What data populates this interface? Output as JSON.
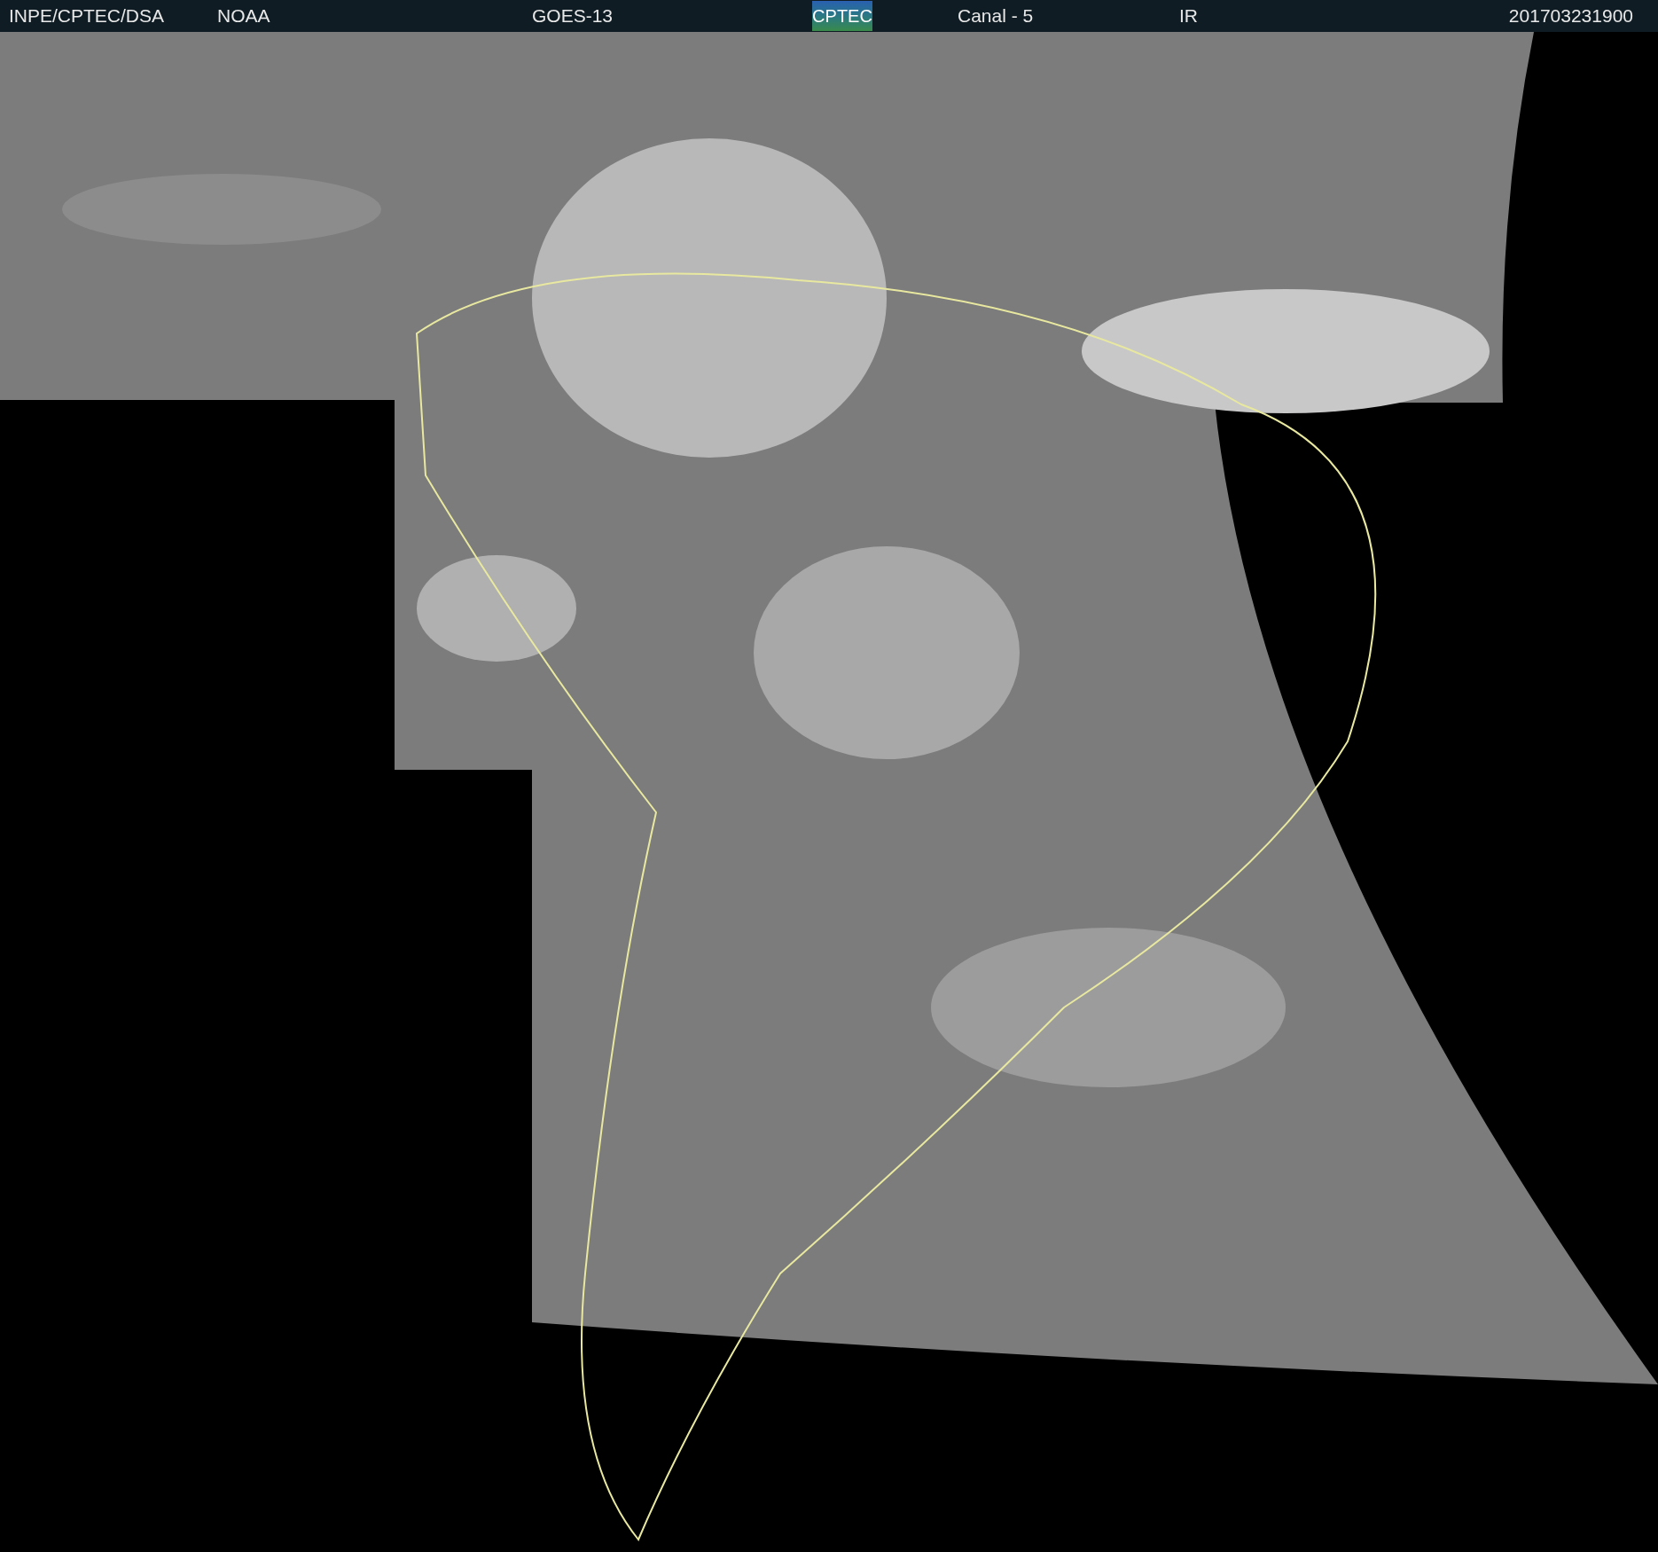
{
  "header": {
    "source": "INPE/CPTEC/DSA",
    "agency": "NOAA",
    "satellite": "GOES-13",
    "logo": "CPTEC",
    "channel": "Canal - 5",
    "band": "IR",
    "timestamp": "201703231900"
  }
}
